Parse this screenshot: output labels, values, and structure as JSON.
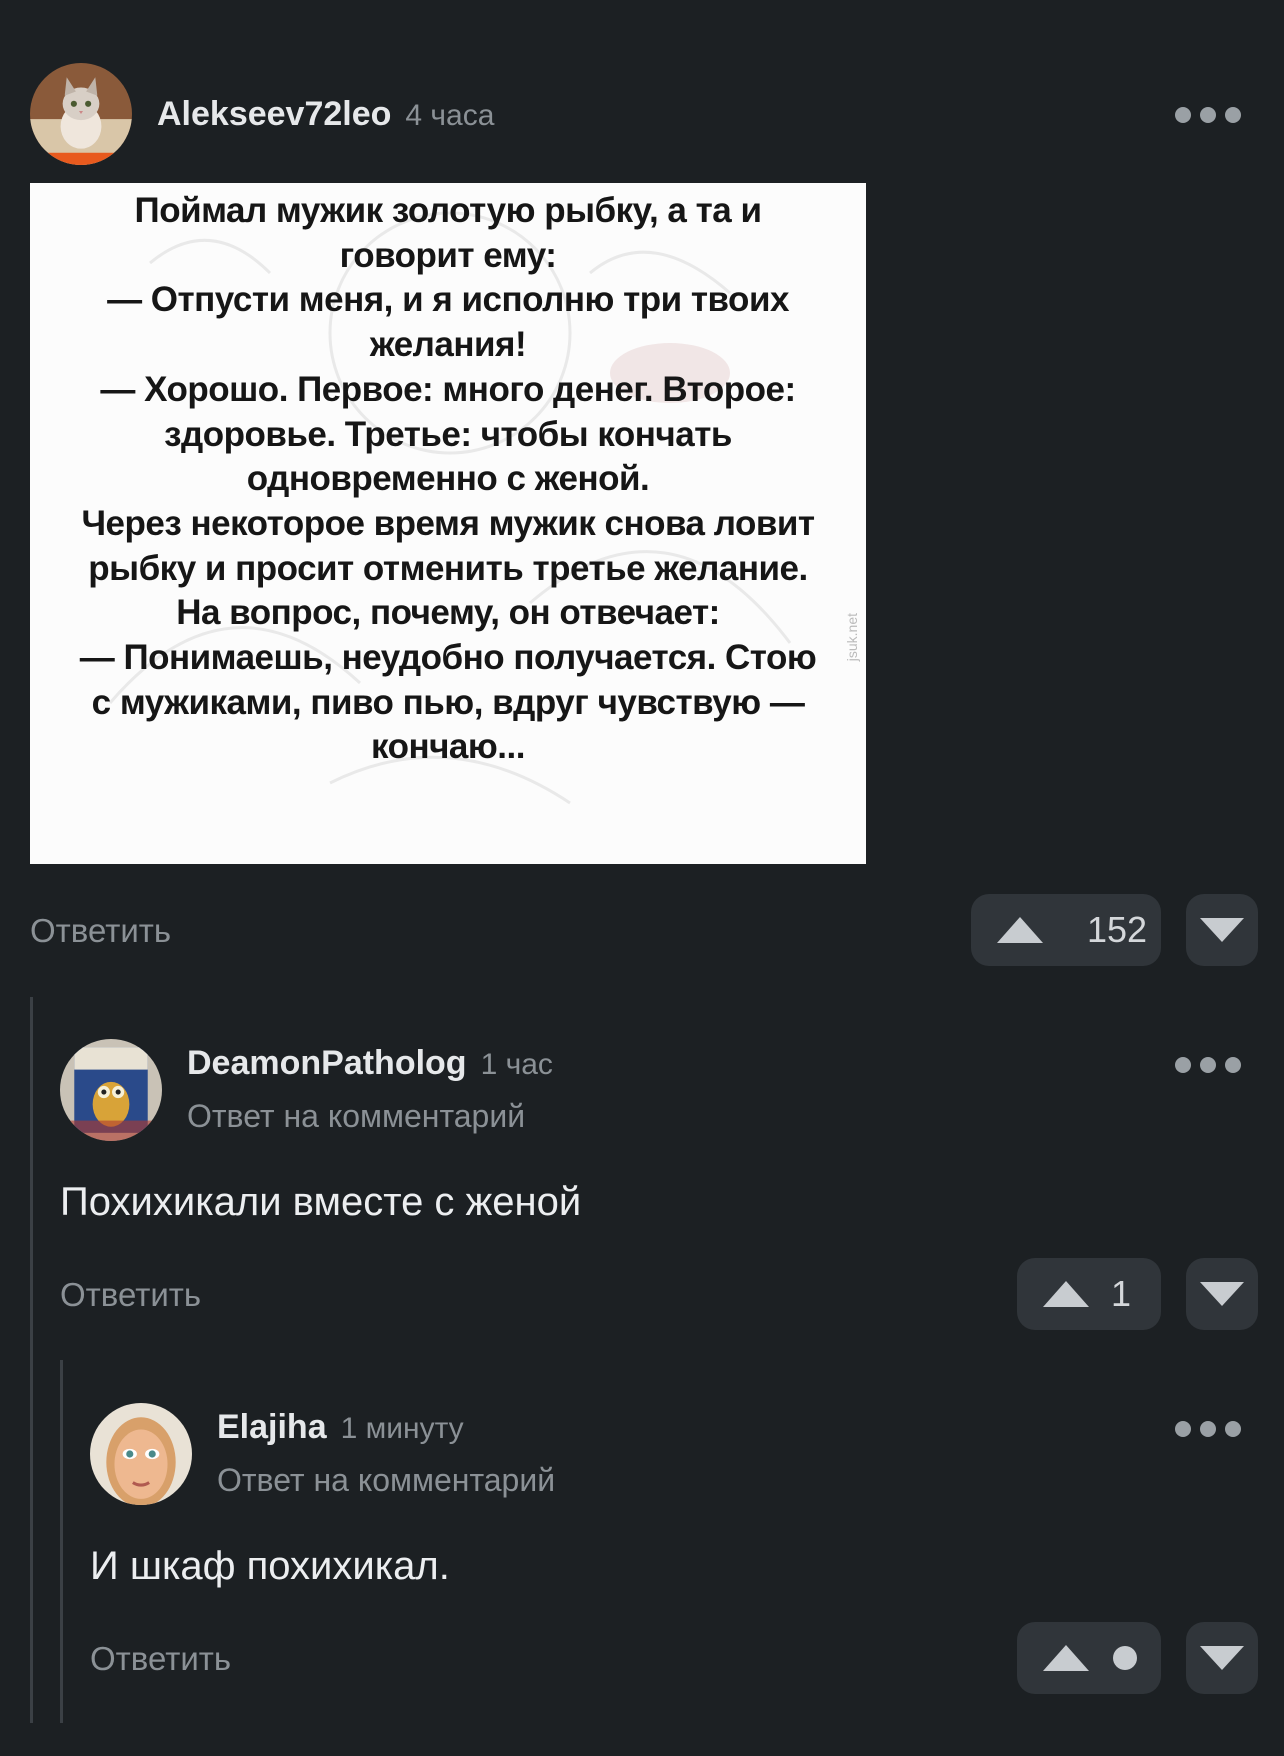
{
  "comments": [
    {
      "author": "Alekseev72leo",
      "time": "4 часа",
      "image_lines": [
        "Поймал мужик золотую рыбку, а та и",
        "говорит ему:",
        "— Отпусти меня, и я исполню три твоих",
        "желания!",
        "— Хорошо. Первое: много денег. Второе:",
        "здоровье. Третье: чтобы кончать",
        "одновременно с женой.",
        "Через некоторое время мужик снова ловит",
        "рыбку и просит отменить третье желание.",
        "На вопрос, почему, он отвечает:",
        "— Понимаешь, неудобно получается. Стою",
        "с мужиками, пиво пью, вдруг чувствую —",
        "кончаю..."
      ],
      "watermark": "jsuk.net",
      "reply_label": "Ответить",
      "votes": "152"
    },
    {
      "author": "DeamonPatholog",
      "time": "1 час",
      "subline": "Ответ на комментарий",
      "text": "Похихикали вместе с женой",
      "reply_label": "Ответить",
      "votes": "1"
    },
    {
      "author": "Elajiha",
      "time": "1 минуту",
      "subline": "Ответ на комментарий",
      "text": "И шкаф похихикал.",
      "reply_label": "Ответить",
      "votes": ""
    }
  ],
  "colors": {
    "background": "#1c2023",
    "button": "#30353a",
    "muted_text": "#8b9196",
    "thread_line": "#3b4045"
  },
  "icons": [
    "more-dots-icon",
    "upvote-arrow-icon",
    "downvote-arrow-icon",
    "pending-dot-icon"
  ]
}
